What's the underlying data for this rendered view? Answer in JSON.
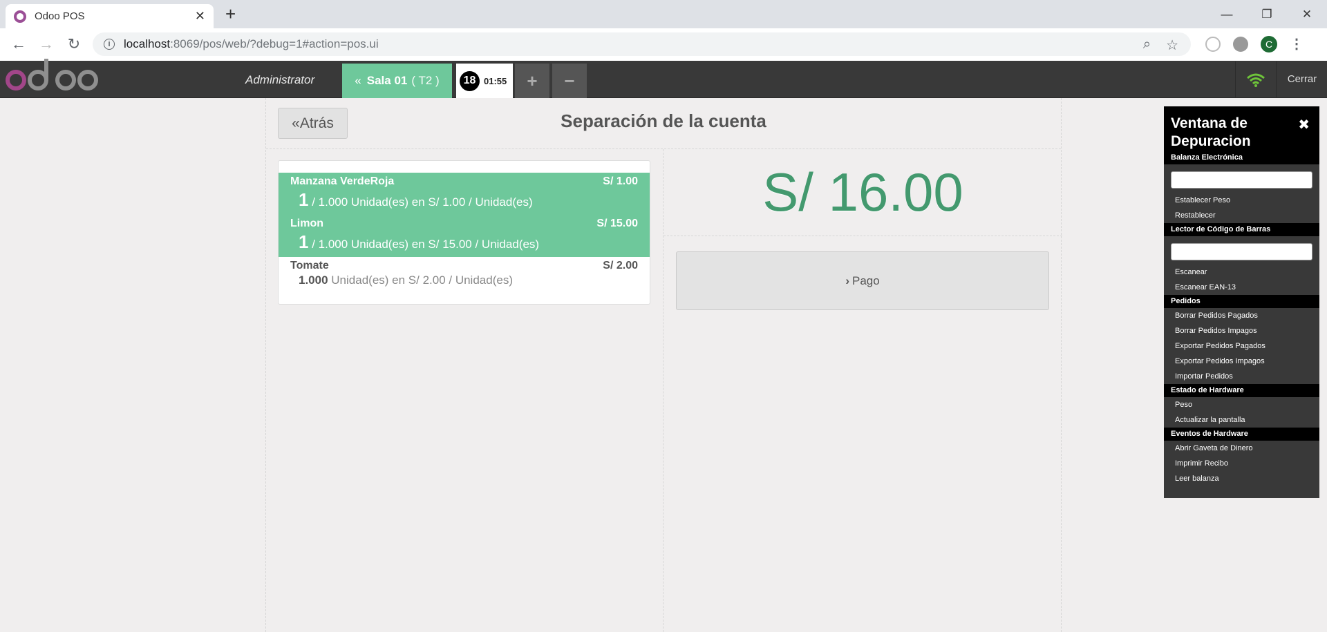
{
  "browser": {
    "tab_title": "Odoo POS",
    "url_host": "localhost",
    "url_rest": ":8069/pos/web/?debug=1#action=pos.ui",
    "profile_initial": "C"
  },
  "header": {
    "user": "Administrator",
    "floor_name": "Sala 01",
    "table_name": "( T2 )",
    "order_sequence": "18",
    "order_time": "01:55",
    "close_label": "Cerrar"
  },
  "screen": {
    "back_label": "Atrás",
    "title": "Separación de la cuenta",
    "total": "S/ 16.00",
    "pay_label": "Pago"
  },
  "orderlines": [
    {
      "product": "Manzana VerdeRoja",
      "price": "S/ 1.00",
      "selected_qty": "1",
      "info": "/ 1.000 Unidad(es) en S/ 1.00 / Unidad(es)",
      "selected": true
    },
    {
      "product": "Limon",
      "price": "S/ 15.00",
      "selected_qty": "1",
      "info": "/ 1.000 Unidad(es) en S/ 15.00 / Unidad(es)",
      "selected": true
    },
    {
      "product": "Tomate",
      "price": "S/ 2.00",
      "selected_qty": "1.000",
      "info": "Unidad(es) en S/ 2.00 / Unidad(es)",
      "selected": false
    }
  ],
  "debug": {
    "title": "Ventana de Depuracion",
    "scale_cat": "Balanza Electrónica",
    "set_weight": "Establecer Peso",
    "reset": "Restablecer",
    "barcode_cat": "Lector de Código de Barras",
    "scan": "Escanear",
    "scan_ean": "Escanear EAN-13",
    "orders_cat": "Pedidos",
    "del_paid": "Borrar Pedidos Pagados",
    "del_unpaid": "Borrar Pedidos Impagos",
    "exp_paid": "Exportar Pedidos Pagados",
    "exp_unpaid": "Exportar Pedidos Impagos",
    "import": "Importar Pedidos",
    "hw_status_cat": "Estado de Hardware",
    "weight": "Peso",
    "refresh": "Actualizar la pantalla",
    "hw_events_cat": "Eventos de Hardware",
    "cashbox": "Abrir Gaveta de Dinero",
    "print": "Imprimir Recibo",
    "read_scale": "Leer balanza"
  }
}
